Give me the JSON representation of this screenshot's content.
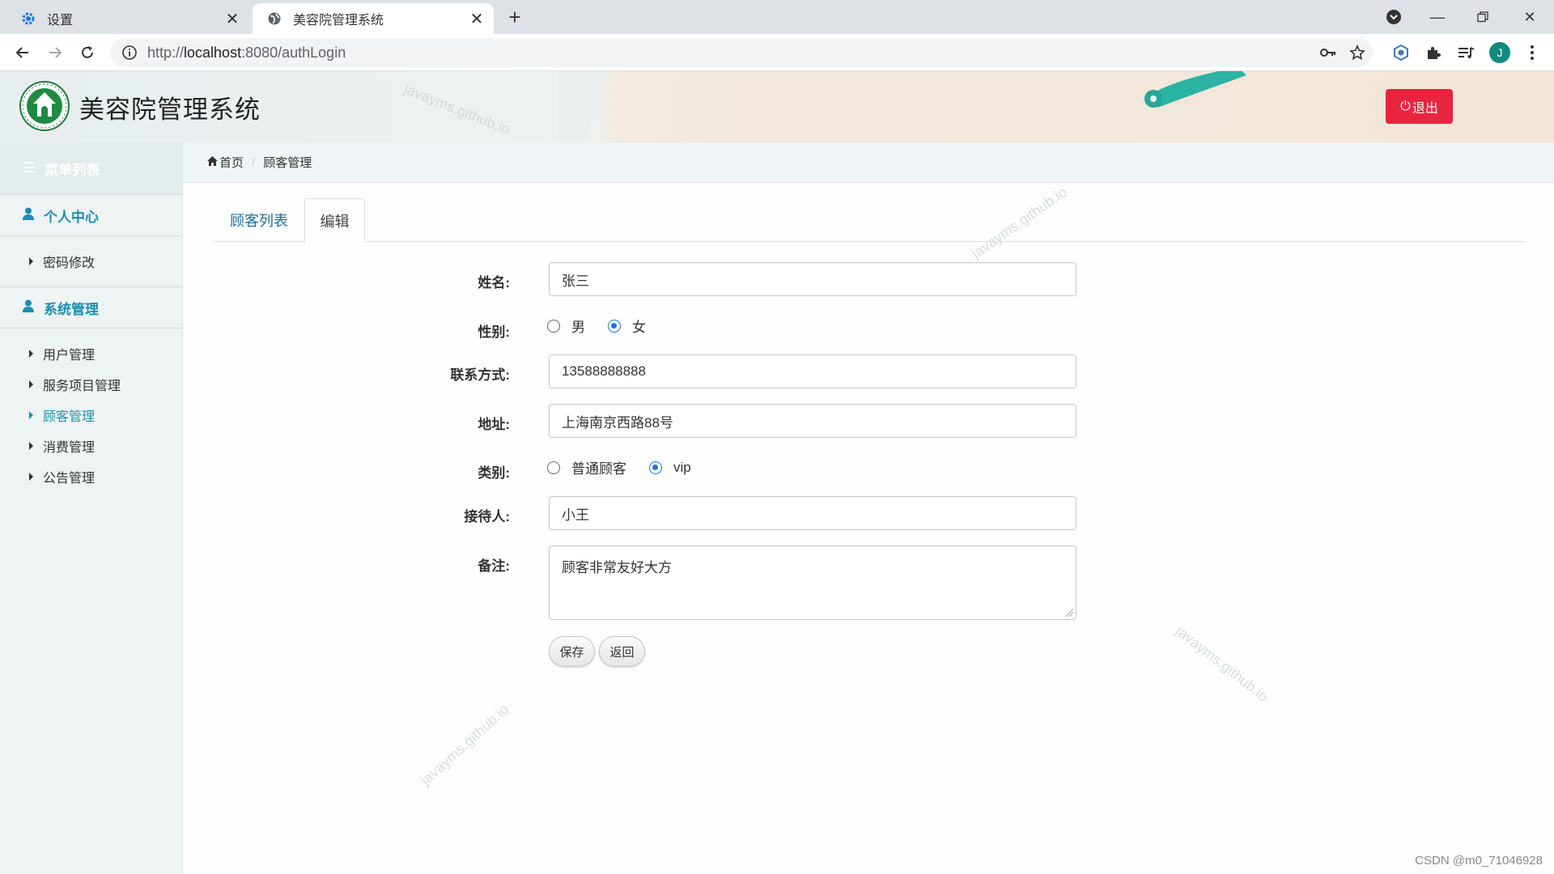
{
  "browser": {
    "tabs": [
      {
        "title": "设置",
        "icon": "gear-icon",
        "active": false
      },
      {
        "title": "美容院管理系统",
        "icon": "globe-icon",
        "active": true
      }
    ],
    "url_prefix": "http://",
    "url_host": "localhost",
    "url_rest": ":8080/authLogin",
    "profile_initial": "J"
  },
  "header": {
    "title": "美容院管理系统",
    "logout_label": "退出"
  },
  "sidebar": {
    "menu_title": "菜单列表",
    "groups": [
      {
        "label": "个人中心",
        "items": [
          {
            "label": "密码修改",
            "active": false
          }
        ]
      },
      {
        "label": "系统管理",
        "items": [
          {
            "label": "用户管理",
            "active": false
          },
          {
            "label": "服务项目管理",
            "active": false
          },
          {
            "label": "顾客管理",
            "active": true
          },
          {
            "label": "消费管理",
            "active": false
          },
          {
            "label": "公告管理",
            "active": false
          }
        ]
      }
    ]
  },
  "breadcrumb": {
    "home": "首页",
    "current": "顾客管理"
  },
  "tabs": [
    {
      "label": "顾客列表"
    },
    {
      "label": "编辑"
    }
  ],
  "form": {
    "name": {
      "label": "姓名:",
      "value": "张三"
    },
    "gender": {
      "label": "性别:",
      "options": [
        "男",
        "女"
      ],
      "selected": "女"
    },
    "contact": {
      "label": "联系方式:",
      "value": "13588888888"
    },
    "address": {
      "label": "地址:",
      "value": "上海南京西路88号"
    },
    "category": {
      "label": "类别:",
      "options": [
        "普通顾客",
        "vip"
      ],
      "selected": "vip"
    },
    "receptionist": {
      "label": "接待人:",
      "value": "小王"
    },
    "remark": {
      "label": "备注:",
      "value": "顾客非常友好大方"
    },
    "save_label": "保存",
    "back_label": "返回"
  },
  "watermark_text": "javayms.github.io",
  "footer_credit": "CSDN @m0_71046928",
  "colors": {
    "accent": "#1c8fb0",
    "logout": "#e8243f",
    "radio": "#1a73e8"
  }
}
